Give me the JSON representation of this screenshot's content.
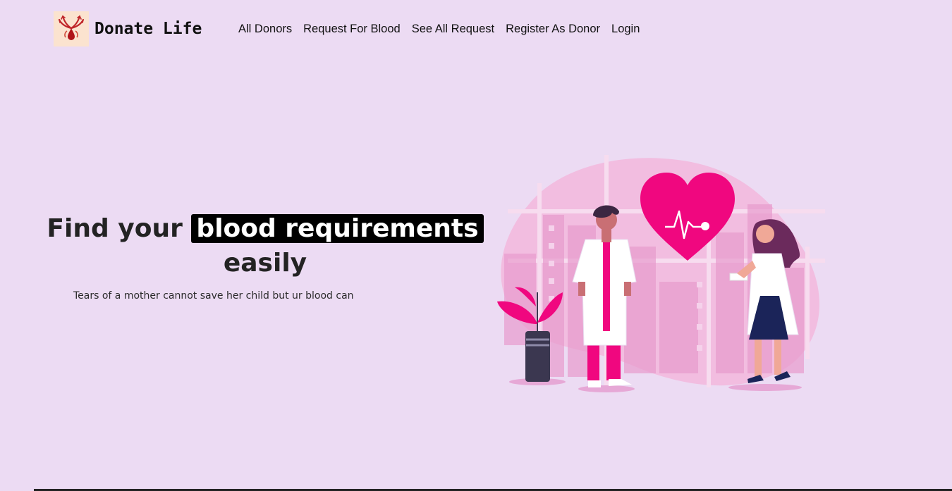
{
  "brand": {
    "logo_icon": "blood-drop-hands-icon",
    "name": "Donate Life"
  },
  "nav": {
    "items": [
      {
        "label": "All Donors"
      },
      {
        "label": "Request For Blood"
      },
      {
        "label": "See All Request"
      },
      {
        "label": "Register As Donor"
      },
      {
        "label": "Login"
      }
    ]
  },
  "hero": {
    "title_prefix": "Find your",
    "title_highlight": "blood requirements",
    "title_suffix": "easily",
    "tagline": "Tears of a mother cannot save her child but ur blood can",
    "illustration_icon": "doctors-heart-illustration"
  },
  "colors": {
    "background": "#ecdbf3",
    "accent": "#f0077f",
    "highlight_bg": "#000000"
  }
}
